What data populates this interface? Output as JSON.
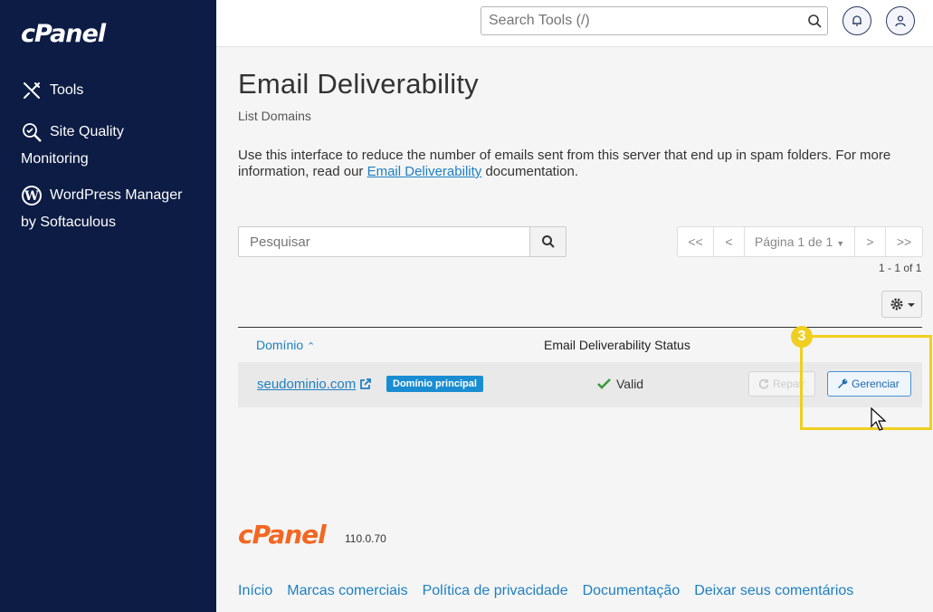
{
  "sidebar": {
    "logo": "cPanel",
    "items": [
      {
        "label": "Tools",
        "icon": "tools-icon"
      },
      {
        "label": "Site Quality",
        "label2": "Monitoring",
        "icon": "site-quality-icon"
      },
      {
        "label": "WordPress Manager",
        "label2": "by Softaculous",
        "icon": "wordpress-icon"
      }
    ]
  },
  "topbar": {
    "search_placeholder": "Search Tools (/)"
  },
  "page": {
    "title": "Email Deliverability",
    "subtitle": "List Domains",
    "desc_before": "Use this interface to reduce the number of emails sent from this server that end up in spam folders. For more information, read our ",
    "desc_link": "Email Deliverability",
    "desc_after": " documentation."
  },
  "filter": {
    "placeholder": "Pesquisar"
  },
  "pager": {
    "first": "<<",
    "prev": "<",
    "page_label": "Página 1 de 1",
    "next": ">",
    "last": ">>",
    "count": "1 - 1 of 1"
  },
  "table": {
    "col_domain": "Domínio",
    "col_status": "Email Deliverability Status",
    "rows": [
      {
        "domain": "seudominio.com",
        "badge": "Domínio principal",
        "status": "Valid",
        "repair_label": "Repair",
        "manage_label": "Gerenciar"
      }
    ]
  },
  "annotation": {
    "step": "3"
  },
  "footer": {
    "logo": "cPanel",
    "version": "110.0.70",
    "links": [
      "Início",
      "Marcas comerciais",
      "Política de privacidade",
      "Documentação",
      "Deixar seus comentários"
    ]
  },
  "colors": {
    "sidebar_bg": "#0c1c44",
    "link": "#1e7fc2",
    "brand_orange": "#f26722",
    "badge": "#1a8dd2",
    "highlight": "#f0cf20"
  }
}
